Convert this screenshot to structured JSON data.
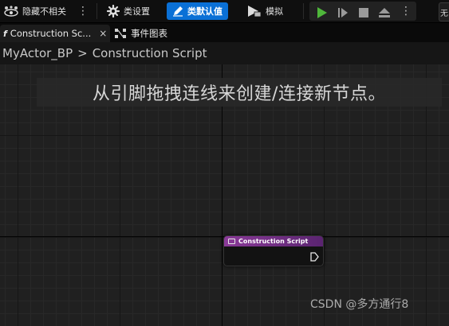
{
  "toolbar": {
    "hide_unrelated_label": "隐藏不相关",
    "class_settings_label": "类设置",
    "class_defaults_label": "类默认值",
    "simulate_label": "模拟",
    "right_stub_label": "无"
  },
  "tabs": [
    {
      "label": "Construction Sc...",
      "close": "×",
      "active": true
    },
    {
      "label": "事件图表",
      "active": false
    }
  ],
  "breadcrumb": {
    "blueprint": "MyActor_BP",
    "separator": ">",
    "graph": "Construction Script"
  },
  "graph": {
    "hint": "从引脚拖拽连线来创建/连接新节点。",
    "node_title": "Construction Script"
  },
  "watermark": "CSDN @多方通行8",
  "colors": {
    "accent": "#0a70d6",
    "play": "#4fb73b",
    "node_header": "#8a3a98"
  }
}
